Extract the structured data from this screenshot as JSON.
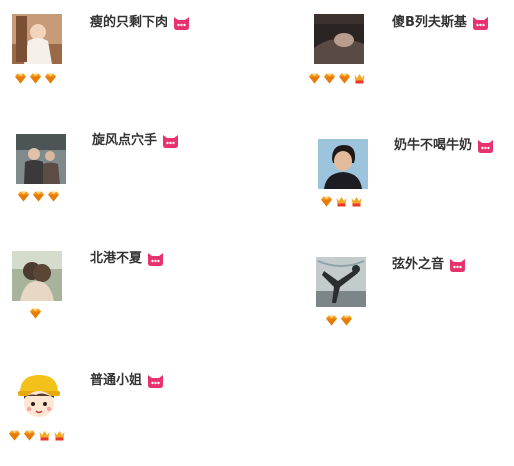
{
  "users": [
    {
      "name": "瘦的只剩下肉",
      "avatar": "avatar-photo",
      "badges": [
        "diamond-icon",
        "diamond-icon",
        "diamond-icon"
      ]
    },
    {
      "name": "傻B列夫斯基",
      "avatar": "avatar-photo",
      "badges": [
        "diamond-icon",
        "diamond-icon",
        "diamond-icon",
        "crown-icon"
      ]
    },
    {
      "name": "旋风点穴手",
      "avatar": "avatar-photo",
      "badges": [
        "diamond-icon",
        "diamond-icon",
        "diamond-icon"
      ]
    },
    {
      "name": "奶牛不喝牛奶",
      "avatar": "avatar-photo",
      "badges": [
        "diamond-icon",
        "crown-icon",
        "crown-icon"
      ]
    },
    {
      "name": "北港不夏",
      "avatar": "avatar-photo",
      "badges": [
        "diamond-icon"
      ]
    },
    {
      "name": "弦外之音",
      "avatar": "avatar-photo",
      "badges": [
        "diamond-icon",
        "diamond-icon"
      ]
    },
    {
      "name": "普通小姐",
      "avatar": "avatar-cartoon",
      "badges": [
        "diamond-icon",
        "diamond-icon",
        "crown-icon",
        "crown-icon"
      ]
    }
  ],
  "icons": {
    "user_tag_icon": "cat-face-icon"
  },
  "colors": {
    "username_text": "#333333",
    "tag_icon": "#e8326e",
    "diamond": "#f59a1c",
    "crown": "#e8392a"
  }
}
